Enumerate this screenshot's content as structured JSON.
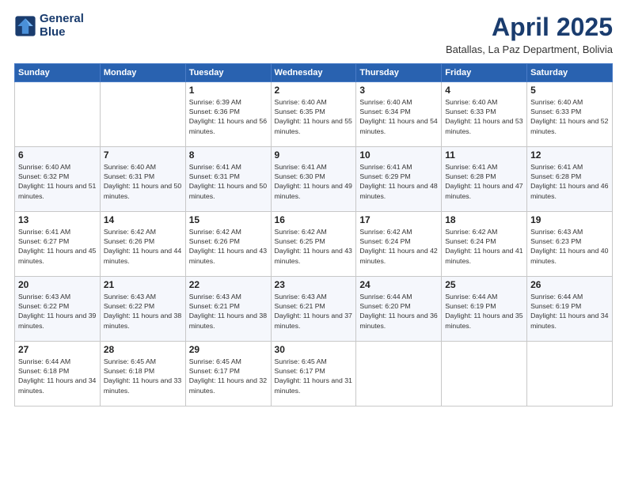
{
  "header": {
    "logo_line1": "General",
    "logo_line2": "Blue",
    "month_title": "April 2025",
    "subtitle": "Batallas, La Paz Department, Bolivia"
  },
  "weekdays": [
    "Sunday",
    "Monday",
    "Tuesday",
    "Wednesday",
    "Thursday",
    "Friday",
    "Saturday"
  ],
  "weeks": [
    [
      {
        "day": "",
        "info": ""
      },
      {
        "day": "",
        "info": ""
      },
      {
        "day": "1",
        "info": "Sunrise: 6:39 AM\nSunset: 6:36 PM\nDaylight: 11 hours and 56 minutes."
      },
      {
        "day": "2",
        "info": "Sunrise: 6:40 AM\nSunset: 6:35 PM\nDaylight: 11 hours and 55 minutes."
      },
      {
        "day": "3",
        "info": "Sunrise: 6:40 AM\nSunset: 6:34 PM\nDaylight: 11 hours and 54 minutes."
      },
      {
        "day": "4",
        "info": "Sunrise: 6:40 AM\nSunset: 6:33 PM\nDaylight: 11 hours and 53 minutes."
      },
      {
        "day": "5",
        "info": "Sunrise: 6:40 AM\nSunset: 6:33 PM\nDaylight: 11 hours and 52 minutes."
      }
    ],
    [
      {
        "day": "6",
        "info": "Sunrise: 6:40 AM\nSunset: 6:32 PM\nDaylight: 11 hours and 51 minutes."
      },
      {
        "day": "7",
        "info": "Sunrise: 6:40 AM\nSunset: 6:31 PM\nDaylight: 11 hours and 50 minutes."
      },
      {
        "day": "8",
        "info": "Sunrise: 6:41 AM\nSunset: 6:31 PM\nDaylight: 11 hours and 50 minutes."
      },
      {
        "day": "9",
        "info": "Sunrise: 6:41 AM\nSunset: 6:30 PM\nDaylight: 11 hours and 49 minutes."
      },
      {
        "day": "10",
        "info": "Sunrise: 6:41 AM\nSunset: 6:29 PM\nDaylight: 11 hours and 48 minutes."
      },
      {
        "day": "11",
        "info": "Sunrise: 6:41 AM\nSunset: 6:28 PM\nDaylight: 11 hours and 47 minutes."
      },
      {
        "day": "12",
        "info": "Sunrise: 6:41 AM\nSunset: 6:28 PM\nDaylight: 11 hours and 46 minutes."
      }
    ],
    [
      {
        "day": "13",
        "info": "Sunrise: 6:41 AM\nSunset: 6:27 PM\nDaylight: 11 hours and 45 minutes."
      },
      {
        "day": "14",
        "info": "Sunrise: 6:42 AM\nSunset: 6:26 PM\nDaylight: 11 hours and 44 minutes."
      },
      {
        "day": "15",
        "info": "Sunrise: 6:42 AM\nSunset: 6:26 PM\nDaylight: 11 hours and 43 minutes."
      },
      {
        "day": "16",
        "info": "Sunrise: 6:42 AM\nSunset: 6:25 PM\nDaylight: 11 hours and 43 minutes."
      },
      {
        "day": "17",
        "info": "Sunrise: 6:42 AM\nSunset: 6:24 PM\nDaylight: 11 hours and 42 minutes."
      },
      {
        "day": "18",
        "info": "Sunrise: 6:42 AM\nSunset: 6:24 PM\nDaylight: 11 hours and 41 minutes."
      },
      {
        "day": "19",
        "info": "Sunrise: 6:43 AM\nSunset: 6:23 PM\nDaylight: 11 hours and 40 minutes."
      }
    ],
    [
      {
        "day": "20",
        "info": "Sunrise: 6:43 AM\nSunset: 6:22 PM\nDaylight: 11 hours and 39 minutes."
      },
      {
        "day": "21",
        "info": "Sunrise: 6:43 AM\nSunset: 6:22 PM\nDaylight: 11 hours and 38 minutes."
      },
      {
        "day": "22",
        "info": "Sunrise: 6:43 AM\nSunset: 6:21 PM\nDaylight: 11 hours and 38 minutes."
      },
      {
        "day": "23",
        "info": "Sunrise: 6:43 AM\nSunset: 6:21 PM\nDaylight: 11 hours and 37 minutes."
      },
      {
        "day": "24",
        "info": "Sunrise: 6:44 AM\nSunset: 6:20 PM\nDaylight: 11 hours and 36 minutes."
      },
      {
        "day": "25",
        "info": "Sunrise: 6:44 AM\nSunset: 6:19 PM\nDaylight: 11 hours and 35 minutes."
      },
      {
        "day": "26",
        "info": "Sunrise: 6:44 AM\nSunset: 6:19 PM\nDaylight: 11 hours and 34 minutes."
      }
    ],
    [
      {
        "day": "27",
        "info": "Sunrise: 6:44 AM\nSunset: 6:18 PM\nDaylight: 11 hours and 34 minutes."
      },
      {
        "day": "28",
        "info": "Sunrise: 6:45 AM\nSunset: 6:18 PM\nDaylight: 11 hours and 33 minutes."
      },
      {
        "day": "29",
        "info": "Sunrise: 6:45 AM\nSunset: 6:17 PM\nDaylight: 11 hours and 32 minutes."
      },
      {
        "day": "30",
        "info": "Sunrise: 6:45 AM\nSunset: 6:17 PM\nDaylight: 11 hours and 31 minutes."
      },
      {
        "day": "",
        "info": ""
      },
      {
        "day": "",
        "info": ""
      },
      {
        "day": "",
        "info": ""
      }
    ]
  ]
}
